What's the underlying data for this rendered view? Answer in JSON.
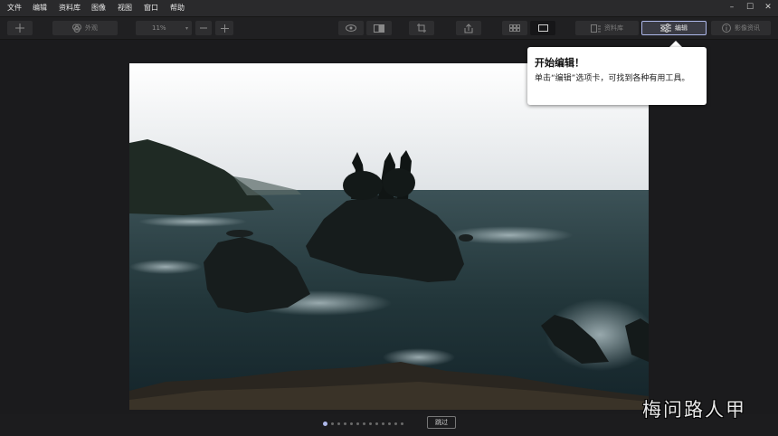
{
  "menu": [
    "文件",
    "编辑",
    "资料库",
    "图像",
    "视图",
    "窗口",
    "帮助"
  ],
  "toolbar": {
    "add_icon": "plus-icon",
    "appearance_label": "外观",
    "zoom_value": "11%",
    "zoom_out_icon": "minus-icon",
    "zoom_in_icon": "plus-icon",
    "library_label": "资料库",
    "edit_label": "编辑",
    "info_label": "影像资讯"
  },
  "tooltip": {
    "title": "开始编辑！",
    "body": "单击“编辑”选项卡，可找到各种有用工具。"
  },
  "pager": {
    "dot_count": 13,
    "active_index": 0,
    "skip_label": "跳过"
  },
  "watermark": "梅问路人甲",
  "colors": {
    "accent": "#aeb8ea",
    "background": "#1c1c1e",
    "toolbar": "#202022"
  }
}
